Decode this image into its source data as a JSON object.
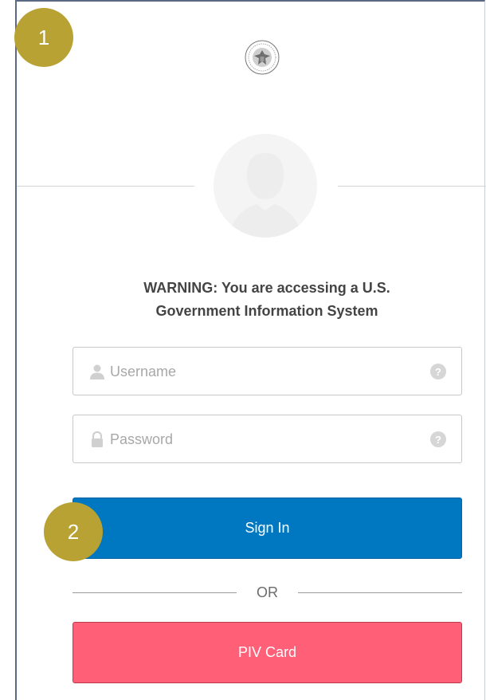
{
  "badges": {
    "step_1": "1",
    "step_2": "2",
    "color": "#b8a233"
  },
  "header": {
    "seal_icon": "government-seal-icon"
  },
  "avatar": {
    "icon": "user-avatar-icon"
  },
  "warning": {
    "line_1": "WARNING: You are accessing a U.S.",
    "line_2": "Government Information System"
  },
  "form": {
    "username": {
      "placeholder": "Username",
      "value": "",
      "icon": "user-icon",
      "help_icon": "question-icon",
      "help_glyph": "?"
    },
    "password": {
      "placeholder": "Password",
      "value": "",
      "icon": "lock-icon",
      "help_icon": "question-icon",
      "help_glyph": "?"
    },
    "sign_in_label": "Sign In",
    "separator_label": "OR",
    "piv_label": "PIV Card"
  },
  "colors": {
    "sign_in": "#0078c1",
    "piv": "#ff6078",
    "frame_border": "#5a6a85"
  }
}
